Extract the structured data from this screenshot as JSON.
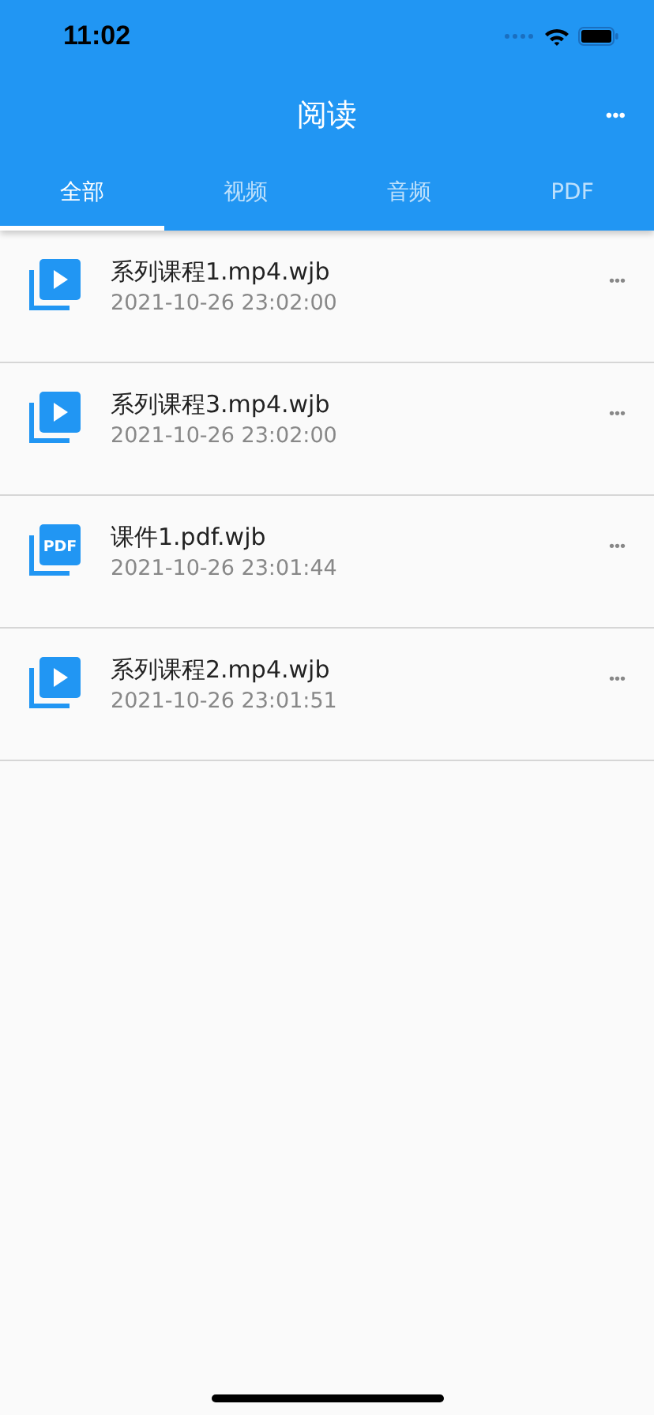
{
  "status_bar": {
    "time": "11:02"
  },
  "header": {
    "title": "阅读",
    "more": "•••"
  },
  "tabs": [
    {
      "label": "全部",
      "selected": true
    },
    {
      "label": "视频",
      "selected": false
    },
    {
      "label": "音频",
      "selected": false
    },
    {
      "label": "PDF",
      "selected": false
    }
  ],
  "files": [
    {
      "kind": "video",
      "name": "系列课程1.mp4.wjb",
      "date": "2021-10-26 23:02:00",
      "more": "•••"
    },
    {
      "kind": "video",
      "name": "系列课程3.mp4.wjb",
      "date": "2021-10-26 23:02:00",
      "more": "•••"
    },
    {
      "kind": "pdf",
      "icon_label": "PDF",
      "name": "课件1.pdf.wjb",
      "date": "2021-10-26 23:01:44",
      "more": "•••"
    },
    {
      "kind": "video",
      "name": "系列课程2.mp4.wjb",
      "date": "2021-10-26 23:01:51",
      "more": "•••"
    }
  ]
}
